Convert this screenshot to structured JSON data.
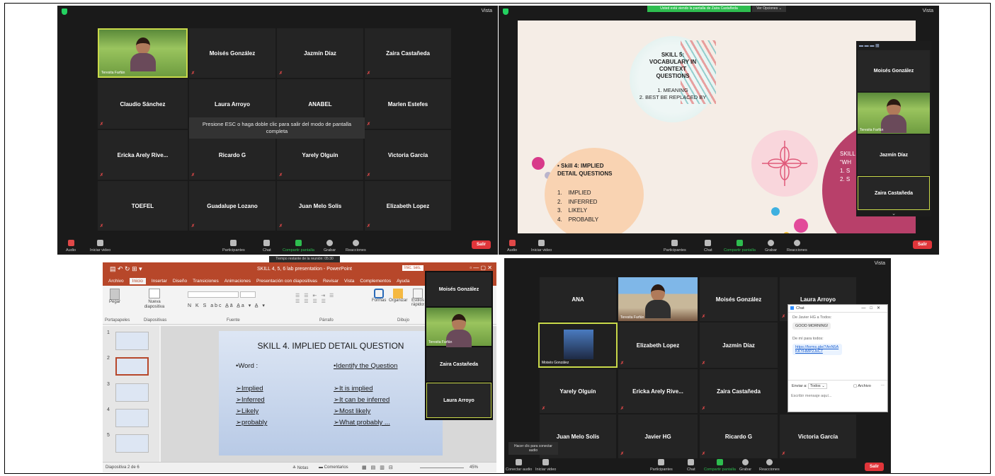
{
  "q1": {
    "view_label": "Vista",
    "self_name": "Teresita Farfán",
    "tiles": [
      "Moisés González",
      "Jazmín Díaz",
      "Zaira Castañeda",
      "Claudio Sánchez",
      "Laura Arroyo",
      "ANABEL",
      "Marlen Estefes",
      "Ericka Arely Rive...",
      "Ricardo G",
      "Yarely Olguín",
      "Victoria García",
      "TOEFEL",
      "Guadalupe Lozano",
      "Juan Melo Solís",
      "Elizabeth Lopez"
    ],
    "toast": "Presione ESC o haga doble clic para salir del modo de pantalla completa",
    "toolbar": {
      "audio": "Audio",
      "video": "Iniciar video",
      "participants": "Participantes",
      "participants_count": "15",
      "chat": "Chat",
      "share": "Compartir pantalla",
      "record": "Grabar",
      "reactions": "Reacciones",
      "leave": "Salir"
    }
  },
  "q2": {
    "view_label": "Vista",
    "share_banner": "Usted está viendo la pantalla de Zaira Castañeda",
    "view_options": "Ver Opciones ⌄",
    "skill5": {
      "title": "SKILL 5: VOCABULARY IN CONTEXT QUESTIONS",
      "item1": "1. MEANING",
      "item2": "2. BEST BE REPLACED BY"
    },
    "skill4": {
      "title": "Skill 4: IMPLIED DETAIL QUESTIONS",
      "items": [
        "IMPLIED",
        "INFERRED",
        "LIKELY",
        "PROBABLY"
      ]
    },
    "skill6_fragment": {
      "line1": "SKILL",
      "line2": "“WH",
      "line3": "1.  S",
      "line4": "2.  S"
    },
    "side_tiles": [
      "Moisés González",
      "Jazmín Díaz",
      "Zaira Castañeda"
    ],
    "self_name": "Teresita Farfán",
    "toolbar": {
      "audio": "Audio",
      "video": "Iniciar video",
      "participants": "Participantes",
      "participants_count": "15",
      "chat": "Chat",
      "share": "Compartir pantalla",
      "record": "Grabar",
      "reactions": "Reacciones",
      "leave": "Salir"
    }
  },
  "q3": {
    "timer": "Tiempo restante de la reunión: 05:30",
    "title": "SKILL 4, 5, 6 lab presentation  -  PowerPoint",
    "signin": "Inic. ses.",
    "tabs": [
      "Archivo",
      "Inicio",
      "Insertar",
      "Diseño",
      "Transiciones",
      "Animaciones",
      "Presentación con diapositivas",
      "Revisar",
      "Vista",
      "Complementos",
      "Ayuda"
    ],
    "groups": {
      "clipboard": "Portapapeles",
      "slides": "Diapositivas",
      "font": "Fuente",
      "paragraph": "Párrafo",
      "drawing": "Dibujo"
    },
    "ribbon_buttons": {
      "paste": "Pegar",
      "new_slide": "Nueva diapositiva",
      "shapes": "Formas",
      "arrange": "Organizar",
      "styles": "Estilos rápidos"
    },
    "thumbs": [
      "1",
      "2",
      "3",
      "4",
      "5"
    ],
    "slide": {
      "title": "SKILL 4. IMPLIED DETAIL QUESTION",
      "left_head": "•Word :",
      "right_head": "•Identify the Question",
      "left_items": [
        "➢Implied",
        "➢Inferred",
        "➢Likely",
        "➢probably"
      ],
      "right_items": [
        "➢It is implied",
        "➢It can be inferred",
        "➢Most likely",
        "➢What probably ..."
      ]
    },
    "status": {
      "slide_count": "Diapositiva 2 de 6",
      "notes": "Notas",
      "comments": "Comentarios",
      "zoom": "45%"
    },
    "side_tiles": [
      "Moisés González",
      "Zaira Castañeda",
      "Laura Arroyo"
    ],
    "self_name": "Teresita Farfán"
  },
  "q4": {
    "view_label": "Vista",
    "tiles": [
      "ANA",
      "Moisés González",
      "Laura Arroyo",
      "Elizabeth Lopez",
      "Jazmín Díaz",
      "Yarely Olguín",
      "Ericka Arely Rive...",
      "Zaira Castañeda",
      "Juan Melo Solís",
      "Javier HG",
      "Ricardo G",
      "Victoria García"
    ],
    "video_names": [
      "Teresita Farfán",
      "Moisés González"
    ],
    "chat": {
      "title": "Chat",
      "msg1_from": "De Javier HG a Todos:",
      "msg1": "GOOD MORNING!",
      "msg2_from": "De mí para todos:",
      "msg2": "https://forms.gle/7AnN5AKKYHMP2JsC7",
      "send_to": "Enviar a:",
      "recipient": "Todos ⌄",
      "files": "Archivo",
      "placeholder": "Escribir mensaje aquí..."
    },
    "connect_tip": "Hacer clic para conectar audio",
    "toolbar": {
      "audio": "Conectar audio",
      "video": "Iniciar video",
      "participants": "Participantes",
      "participants_count": "15",
      "chat": "Chat",
      "share": "Compartir pantalla",
      "record": "Grabar",
      "reactions": "Reacciones",
      "leave": "Salir"
    }
  }
}
